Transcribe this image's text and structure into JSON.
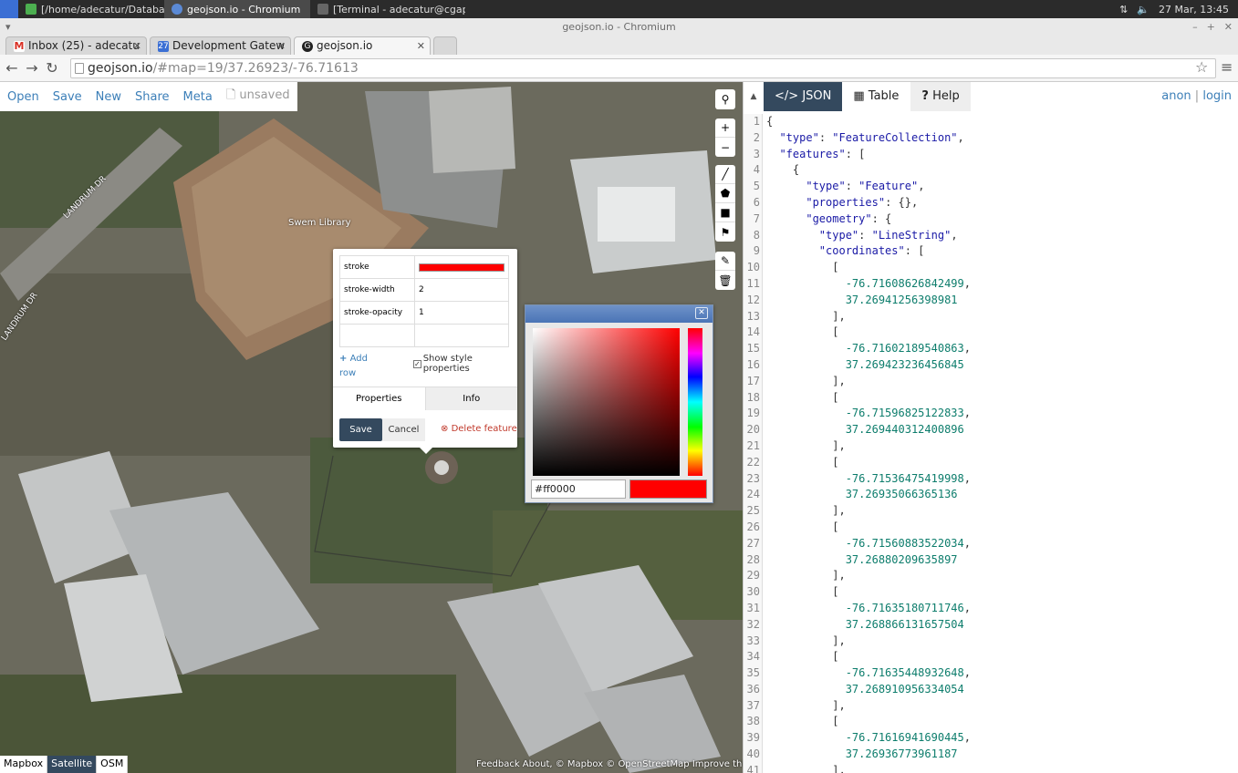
{
  "taskbar": {
    "apps": [
      {
        "label": "[/home/adecatur/Databas...",
        "icon": "folder-icon",
        "color": "#4caf50"
      },
      {
        "label": "geojson.io - Chromium",
        "icon": "chromium-icon",
        "color": "#5b8ad6"
      },
      {
        "label": "[Terminal - adecatur@cgap...",
        "icon": "terminal-icon",
        "color": "#666"
      }
    ],
    "clock": "27 Mar, 13:45"
  },
  "window": {
    "title": "geojson.io - Chromium"
  },
  "browser_tabs": [
    {
      "label": "Inbox (25) - adecatu",
      "favicon": "gmail-icon",
      "color": "#d93025",
      "glyph": "M"
    },
    {
      "label": "Development Gatew",
      "favicon": "calendar-icon",
      "color": "#3b6fd4",
      "glyph": "27"
    },
    {
      "label": "geojson.io",
      "favicon": "geojson-icon",
      "color": "#222",
      "glyph": "G"
    }
  ],
  "address": {
    "host": "geojson.io",
    "path": "/#map=19/37.26923/-76.71613"
  },
  "menu": {
    "open": "Open",
    "save": "Save",
    "new": "New",
    "share": "Share",
    "meta": "Meta",
    "unsaved": "unsaved"
  },
  "map": {
    "building_label": "Swem Library",
    "road_label_1": "LANDRUM DR",
    "road_label_2": "LANDRUM DR",
    "basemaps": [
      "Mapbox",
      "Satellite",
      "OSM"
    ],
    "active_basemap": "Satellite",
    "attribution": "Feedback About, © Mapbox © OpenStreetMap Improve this map"
  },
  "popup": {
    "rows": [
      {
        "key": "stroke",
        "value": ""
      },
      {
        "key": "stroke-width",
        "value": "2"
      },
      {
        "key": "stroke-opacity",
        "value": "1"
      },
      {
        "key": "",
        "value": ""
      }
    ],
    "stroke_color": "#ff0000",
    "add_row": "Add row",
    "show_style": "Show style properties",
    "show_style_checked": true,
    "tab_properties": "Properties",
    "tab_info": "Info",
    "save": "Save",
    "cancel": "Cancel",
    "delete": "Delete feature"
  },
  "colorpicker": {
    "hex": "#ff0000",
    "color": "#ff0000"
  },
  "panel": {
    "tab_json": "JSON",
    "tab_table": "Table",
    "tab_help": "Help",
    "user": "anon",
    "login": "login"
  },
  "code_lines": [
    "{",
    "  \"type\": \"FeatureCollection\",",
    "  \"features\": [",
    "    {",
    "      \"type\": \"Feature\",",
    "      \"properties\": {},",
    "      \"geometry\": {",
    "        \"type\": \"LineString\",",
    "        \"coordinates\": [",
    "          [",
    "            -76.71608626842499,",
    "            37.26941256398981",
    "          ],",
    "          [",
    "            -76.71602189540863,",
    "            37.269423236456845",
    "          ],",
    "          [",
    "            -76.71596825122833,",
    "            37.269440312400896",
    "          ],",
    "          [",
    "            -76.71536475419998,",
    "            37.26935066365136",
    "          ],",
    "          [",
    "            -76.71560883522034,",
    "            37.26880209635897",
    "          ],",
    "          [",
    "            -76.71635180711746,",
    "            37.268866131657504",
    "          ],",
    "          [",
    "            -76.71635448932648,",
    "            37.268910956334054",
    "          ],",
    "          [",
    "            -76.71616941690445,",
    "            37.26936773961187",
    "          ],"
  ]
}
